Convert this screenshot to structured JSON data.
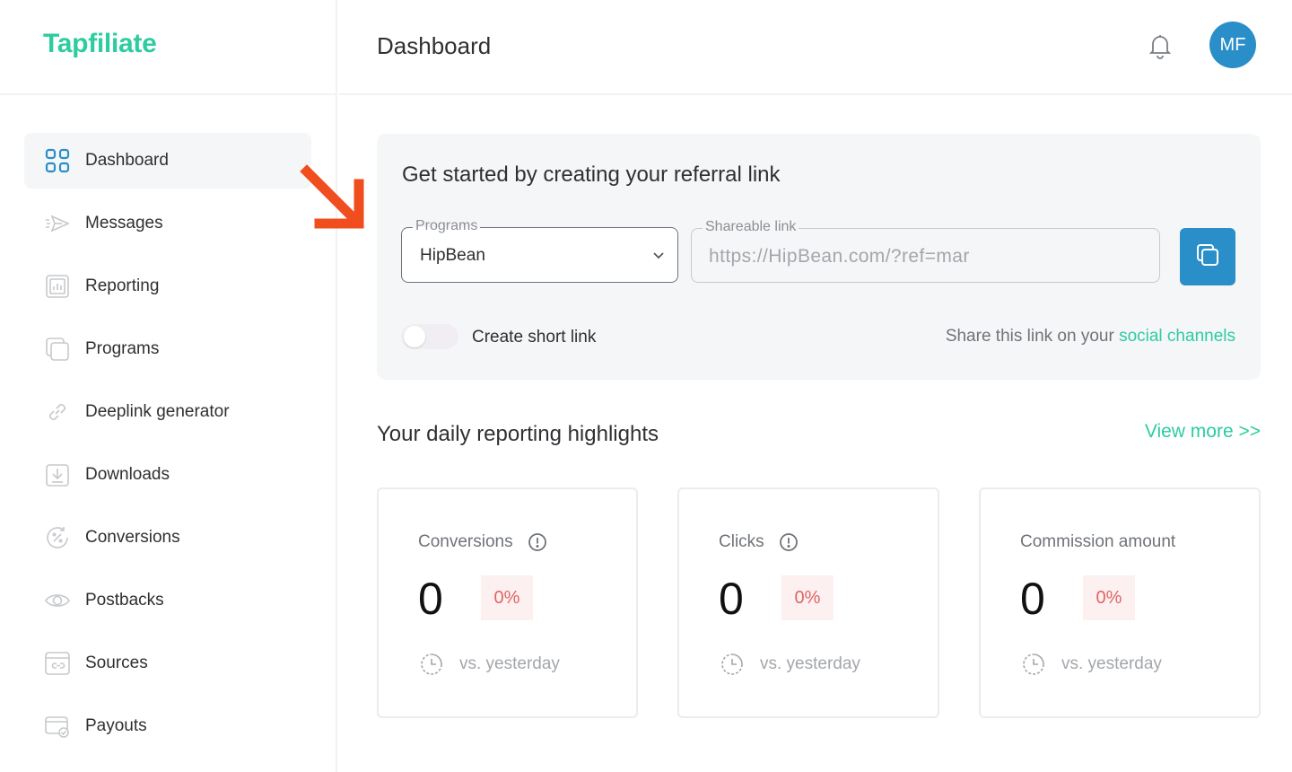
{
  "brand": "Tapfiliate",
  "header": {
    "title": "Dashboard",
    "avatar_initials": "MF",
    "bell_icon": "bell-icon"
  },
  "sidebar": {
    "items": [
      {
        "label": "Dashboard",
        "icon": "grid-icon",
        "active": true
      },
      {
        "label": "Messages",
        "icon": "paper-plane-icon"
      },
      {
        "label": "Reporting",
        "icon": "bar-chart-icon"
      },
      {
        "label": "Programs",
        "icon": "stacked-pages-icon"
      },
      {
        "label": "Deeplink generator",
        "icon": "link-icon"
      },
      {
        "label": "Downloads",
        "icon": "download-icon"
      },
      {
        "label": "Conversions",
        "icon": "percent-icon"
      },
      {
        "label": "Postbacks",
        "icon": "eye-icon"
      },
      {
        "label": "Sources",
        "icon": "browser-link-icon"
      },
      {
        "label": "Payouts",
        "icon": "wallet-check-icon"
      }
    ]
  },
  "referral": {
    "title": "Get started by creating your referral link",
    "programs_legend": "Programs",
    "programs_value": "HipBean",
    "shareable_legend": "Shareable link",
    "shareable_value": "https://HipBean.com/?ref=mar",
    "short_link_label": "Create short link",
    "share_prefix": "Share this link on your ",
    "share_link": "social channels"
  },
  "highlights": {
    "title": "Your daily reporting highlights",
    "view_more": "View more >>",
    "metrics": [
      {
        "label": "Conversions",
        "value": "0",
        "delta": "0%",
        "foot": "vs. yesterday",
        "info": true
      },
      {
        "label": "Clicks",
        "value": "0",
        "delta": "0%",
        "foot": "vs. yesterday",
        "info": true
      },
      {
        "label": "Commission amount",
        "value": "0",
        "delta": "0%",
        "foot": "vs. yesterday",
        "info": false
      }
    ]
  },
  "colors": {
    "brand": "#2ecca0",
    "accent_blue": "#2a8fc8",
    "arrow": "#f04e1e",
    "delta_red": "#e06464"
  }
}
